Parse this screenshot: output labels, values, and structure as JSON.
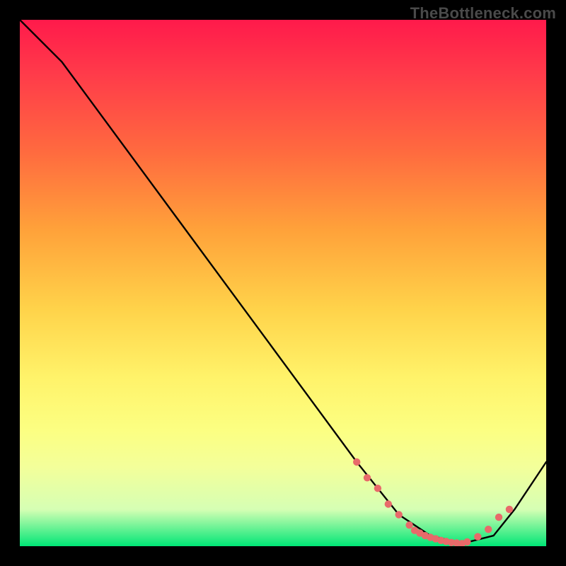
{
  "watermark": "TheBottleneck.com",
  "chart_data": {
    "type": "line",
    "title": "",
    "xlabel": "",
    "ylabel": "",
    "xlim": [
      0,
      100
    ],
    "ylim": [
      0,
      100
    ],
    "gradient_stops": [
      {
        "pct": 0,
        "color": "#ff1a4b"
      },
      {
        "pct": 25,
        "color": "#ff6a3f"
      },
      {
        "pct": 55,
        "color": "#ffd34a"
      },
      {
        "pct": 78,
        "color": "#fcff82"
      },
      {
        "pct": 93,
        "color": "#d6ffb4"
      },
      {
        "pct": 100,
        "color": "#00e676"
      }
    ],
    "series": [
      {
        "name": "bottleneck-curve",
        "color": "#000000",
        "x": [
          0,
          8,
          64,
          72,
          78,
          84,
          90,
          94,
          100
        ],
        "y": [
          100,
          92,
          16,
          6,
          2,
          0.5,
          2,
          7,
          16
        ]
      }
    ],
    "markers": {
      "name": "optimum-band",
      "color": "#e86a6a",
      "x": [
        64,
        66,
        68,
        70,
        72,
        74,
        75,
        76,
        77,
        78,
        79,
        80,
        81,
        82,
        83,
        84,
        85,
        87,
        89,
        91,
        93
      ],
      "y": [
        16,
        13,
        11,
        8,
        6,
        4,
        3,
        2.5,
        2,
        1.7,
        1.4,
        1.1,
        0.9,
        0.7,
        0.6,
        0.5,
        0.8,
        1.8,
        3.2,
        5.5,
        7
      ]
    }
  }
}
